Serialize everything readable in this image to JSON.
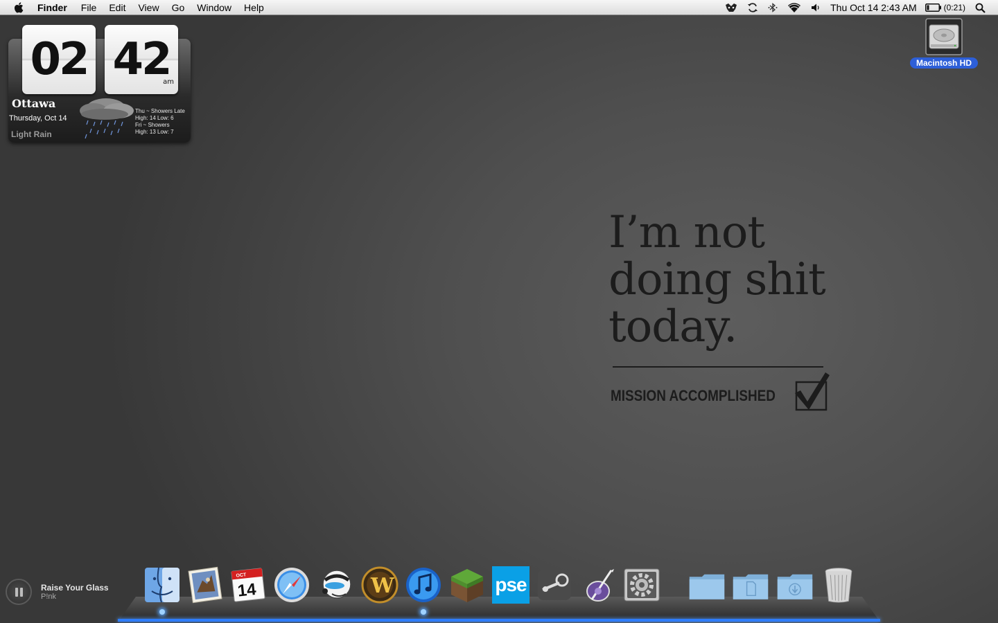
{
  "menubar": {
    "app_name": "Finder",
    "menus": [
      "File",
      "Edit",
      "View",
      "Go",
      "Window",
      "Help"
    ],
    "clock": "Thu Oct 14  2:43 AM",
    "battery": "(0:21)",
    "status_icons": [
      "growl-icon",
      "sync-icon",
      "bluetooth-icon",
      "wifi-icon",
      "volume-icon",
      "battery-icon",
      "spotlight-icon"
    ]
  },
  "clock_widget": {
    "hour": "02",
    "minute": "42",
    "ampm": "am",
    "city": "Ottawa",
    "date": "Thursday, Oct 14",
    "condition": "Light Rain",
    "forecast": [
      "Thu ~ Showers Late",
      "High: 14 Low: 6",
      "Fri ~ Showers",
      "High: 13 Low: 7"
    ]
  },
  "desktop": {
    "drive_label": "Macintosh HD"
  },
  "wallpaper": {
    "quote": "I’m not\ndoing shit\ntoday.",
    "mission": "MISSION ACCOMPLISHED"
  },
  "now_playing": {
    "title": "Raise Your Glass",
    "artist": "P!nk"
  },
  "dock": {
    "items": [
      {
        "name": "finder",
        "running": true
      },
      {
        "name": "mail",
        "running": false
      },
      {
        "name": "ical",
        "running": false
      },
      {
        "name": "safari",
        "running": false
      },
      {
        "name": "adium",
        "running": false
      },
      {
        "name": "world-of-warcraft",
        "running": false
      },
      {
        "name": "itunes",
        "running": true
      },
      {
        "name": "minecraft",
        "running": false
      },
      {
        "name": "photoshop-elements",
        "running": false,
        "label": "pse"
      },
      {
        "name": "steam",
        "running": false
      },
      {
        "name": "script-editor",
        "running": false
      },
      {
        "name": "system-preferences",
        "running": false
      },
      {
        "name": "applications-folder",
        "running": false
      },
      {
        "name": "documents-folder",
        "running": false
      },
      {
        "name": "downloads-folder",
        "running": false
      },
      {
        "name": "trash",
        "running": false
      }
    ]
  }
}
